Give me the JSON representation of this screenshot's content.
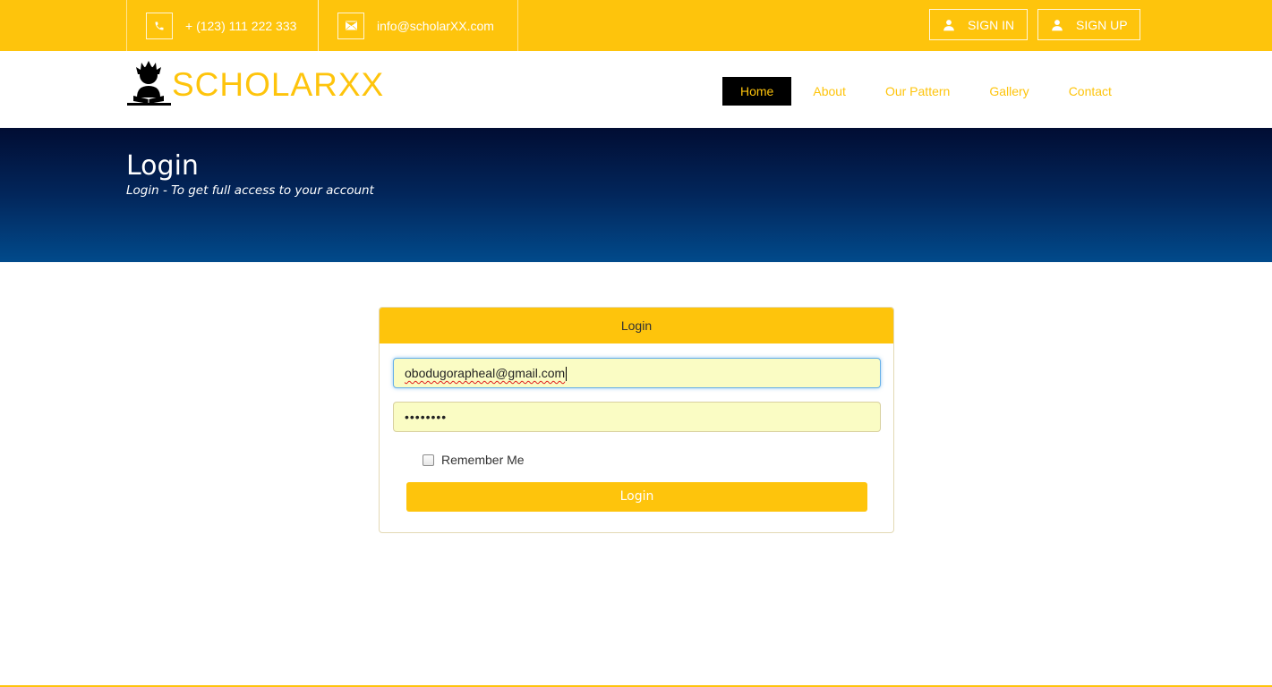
{
  "topbar": {
    "phone": {
      "icon": "phone-icon",
      "text": "+ (123) 111 222 333"
    },
    "email": {
      "icon": "envelope-icon",
      "text": "info@scholarXX.com"
    },
    "signin_label": "SIGN IN",
    "signup_label": "SIGN UP",
    "user_icon": "user-icon"
  },
  "header": {
    "logo_text": "SCHOLARXX",
    "logo_icon": "scholar-reading-icon",
    "nav": [
      {
        "label": "Home",
        "active": true
      },
      {
        "label": "About",
        "active": false
      },
      {
        "label": "Our Pattern",
        "active": false
      },
      {
        "label": "Gallery",
        "active": false
      },
      {
        "label": "Contact",
        "active": false
      }
    ]
  },
  "hero": {
    "title": "Login",
    "subtitle": "Login - To get full access to your account"
  },
  "login_panel": {
    "title": "Login",
    "email_value": "obodugorapheal@gmail.com",
    "password_value": "••••••••",
    "remember_label": "Remember Me",
    "remember_checked": false,
    "submit_label": "Login"
  },
  "colors": {
    "accent": "#fec40c",
    "hero_top": "#010d33",
    "hero_bottom": "#014a8b",
    "input_bg": "#fafcc4"
  }
}
